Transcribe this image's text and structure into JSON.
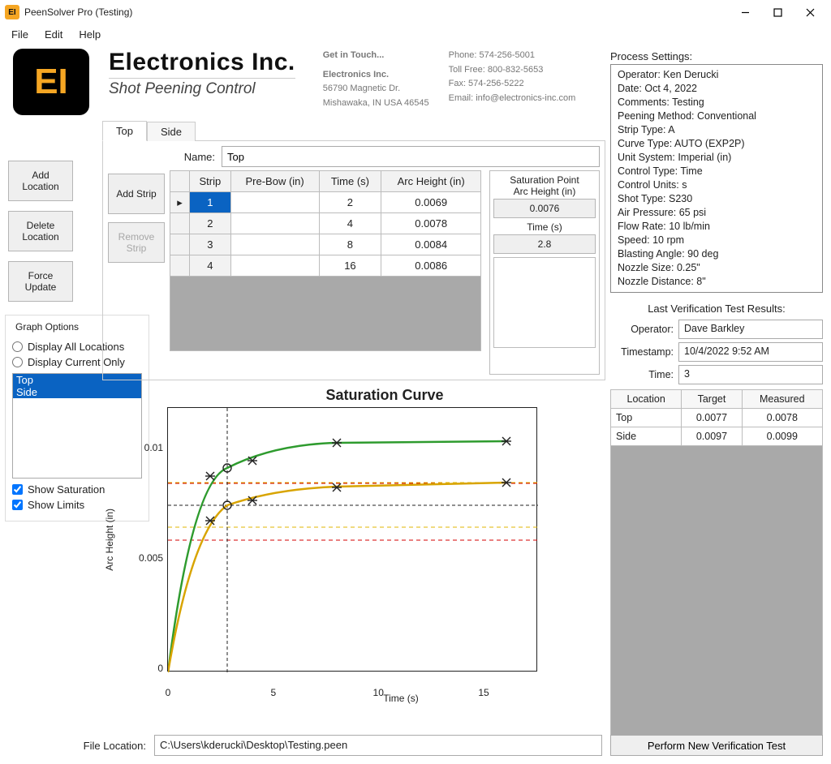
{
  "window": {
    "title": "PeenSolver Pro (Testing)"
  },
  "menu": {
    "file": "File",
    "edit": "Edit",
    "help": "Help"
  },
  "brand": {
    "logo_text": "EI",
    "line1": "Electronics Inc.",
    "line2": "Shot Peening Control",
    "get_in_touch": "Get in Touch...",
    "company": "Electronics Inc.",
    "addr1": "56790 Magnetic Dr.",
    "addr2": "Mishawaka, IN USA 46545",
    "phone": "Phone: 574-256-5001",
    "tollfree": "Toll Free: 800-832-5653",
    "fax": "Fax: 574-256-5222",
    "email": "Email: info@electronics-inc.com"
  },
  "left_buttons": {
    "add_location": "Add\nLocation",
    "delete_location": "Delete\nLocation",
    "force_update": "Force\nUpdate",
    "add_strip": "Add\nStrip",
    "remove_strip": "Remove\nStrip"
  },
  "tabs": {
    "top": "Top",
    "side": "Side"
  },
  "name_label": "Name:",
  "name_value": "Top",
  "grid": {
    "headers": {
      "strip": "Strip",
      "prebow": "Pre-Bow (in)",
      "time": "Time (s)",
      "arc": "Arc Height (in)"
    },
    "rows": [
      {
        "strip": "1",
        "prebow": "",
        "time": "2",
        "arc": "0.0069",
        "selected": true
      },
      {
        "strip": "2",
        "prebow": "",
        "time": "4",
        "arc": "0.0078"
      },
      {
        "strip": "3",
        "prebow": "",
        "time": "8",
        "arc": "0.0084"
      },
      {
        "strip": "4",
        "prebow": "",
        "time": "16",
        "arc": "0.0086"
      }
    ]
  },
  "saturation": {
    "title": "Saturation Point",
    "arc_label": "Arc Height (in)",
    "arc_value": "0.0076",
    "time_label": "Time (s)",
    "time_value": "2.8"
  },
  "graph_options": {
    "title": "Graph Options",
    "display_all": "Display All Locations",
    "display_current": "Display Current Only",
    "locations": [
      "Top",
      "Side"
    ],
    "show_saturation": "Show Saturation",
    "show_limits": "Show Limits"
  },
  "chart_data": {
    "type": "line",
    "title": "Saturation Curve",
    "xlabel": "Time (s)",
    "ylabel": "Arc Height (in)",
    "xlim": [
      0,
      17.5
    ],
    "ylim": [
      0,
      0.012
    ],
    "y_ticks": [
      0,
      0.005,
      0.01
    ],
    "x_ticks": [
      0,
      5,
      10,
      15
    ],
    "series": [
      {
        "name": "Top",
        "color": "#d8a400",
        "points": [
          {
            "x": 2,
            "y": 0.0069
          },
          {
            "x": 4,
            "y": 0.0078
          },
          {
            "x": 8,
            "y": 0.0084
          },
          {
            "x": 16,
            "y": 0.0086
          }
        ],
        "saturation": {
          "x": 2.8,
          "y": 0.0076
        },
        "limits_y": [
          0.006,
          0.0066,
          0.0086,
          0.0092
        ],
        "asymptote": 0.0086
      },
      {
        "name": "Side",
        "color": "#2e9b2e",
        "points": [
          {
            "x": 2,
            "y": 0.0089
          },
          {
            "x": 4,
            "y": 0.0096
          },
          {
            "x": 8,
            "y": 0.0104
          },
          {
            "x": 16,
            "y": 0.0105
          }
        ],
        "saturation": {
          "x": 2.8,
          "y": 0.0093
        },
        "asymptote": 0.0105
      }
    ]
  },
  "process": {
    "title": "Process Settings:",
    "lines": [
      "Operator: Ken Derucki",
      "Date: Oct 4, 2022",
      "Comments: Testing",
      "Peening Method: Conventional",
      "Strip Type: A",
      "Curve Type: AUTO (EXP2P)",
      "Unit System: Imperial (in)",
      "Control Type: Time",
      "Control Units: s",
      "Shot Type: S230",
      "Air Pressure: 65 psi",
      "Flow Rate: 10 lb/min",
      "Speed: 10 rpm",
      "Blasting Angle: 90 deg",
      "Nozzle Size: 0.25\"",
      "Nozzle Distance: 8\""
    ]
  },
  "verification": {
    "title": "Last Verification Test Results:",
    "operator_label": "Operator:",
    "operator": "Dave Barkley",
    "timestamp_label": "Timestamp:",
    "timestamp": "10/4/2022 9:52 AM",
    "time_label": "Time:",
    "time": "3",
    "headers": {
      "location": "Location",
      "target": "Target",
      "measured": "Measured"
    },
    "rows": [
      {
        "location": "Top",
        "target": "0.0077",
        "measured": "0.0078"
      },
      {
        "location": "Side",
        "target": "0.0097",
        "measured": "0.0099"
      }
    ],
    "button": "Perform New Verification Test"
  },
  "footer": {
    "label": "File Location:",
    "path": "C:\\Users\\kderucki\\Desktop\\Testing.peen"
  }
}
